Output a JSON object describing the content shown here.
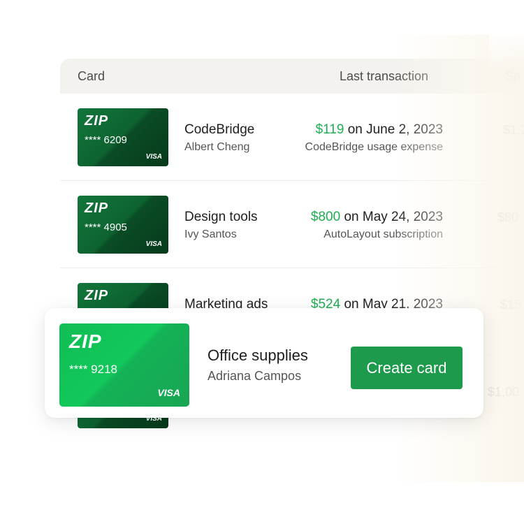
{
  "table": {
    "headers": {
      "card": "Card",
      "last_transaction": "Last transaction",
      "spend": "Sp"
    },
    "rows": [
      {
        "card": {
          "logo": "ZIP",
          "number": "**** 6209",
          "network": "VISA"
        },
        "name": "CodeBridge",
        "owner": "Albert Cheng",
        "tx_amount": "$119",
        "tx_date": " on June 2, 2023",
        "tx_desc": "CodeBridge usage expense",
        "spend": "$1,2"
      },
      {
        "card": {
          "logo": "ZIP",
          "number": "**** 4905",
          "network": "VISA"
        },
        "name": "Design tools",
        "owner": "Ivy Santos",
        "tx_amount": "$800",
        "tx_date": " on May 24, 2023",
        "tx_desc": "AutoLayout subscription",
        "spend": "$80"
      },
      {
        "card": {
          "logo": "ZIP",
          "number": "",
          "network": ""
        },
        "name": "Marketing ads",
        "owner": "",
        "tx_amount": "$524",
        "tx_date": " on May 21, 2023",
        "tx_desc": "",
        "spend": "$15"
      },
      {
        "card": {
          "logo": "",
          "number": "",
          "network": "VISA"
        },
        "name": "",
        "owner": "",
        "tx_amount": "",
        "tx_date": "",
        "tx_desc": "",
        "spend": "$1,00"
      }
    ]
  },
  "popup": {
    "card": {
      "logo": "ZIP",
      "number": "**** 9218",
      "network": "VISA"
    },
    "name": "Office supplies",
    "owner": "Adriana Campos",
    "button_label": "Create card"
  },
  "colors": {
    "accent_green": "#1fae52",
    "button_green": "#1e9a4c",
    "card_dark_green": "#0d6330",
    "card_bright_green": "#12c85a",
    "header_bg": "#f3f2ee"
  }
}
